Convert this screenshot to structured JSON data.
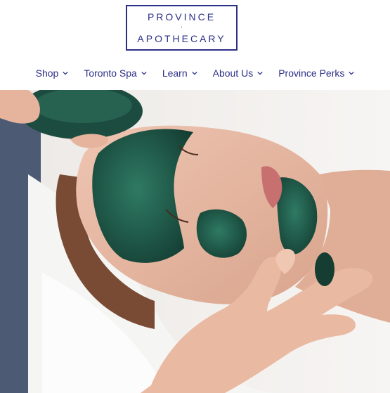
{
  "brand": {
    "line1": "PROVINCE",
    "separator": "·",
    "line2": "APOTHECARY",
    "color": "#2b2f86"
  },
  "nav": {
    "items": [
      {
        "label": "Shop",
        "icon": "chevron-down-icon"
      },
      {
        "label": "Toronto Spa",
        "icon": "chevron-down-icon"
      },
      {
        "label": "Learn",
        "icon": "chevron-down-icon"
      },
      {
        "label": "About Us",
        "icon": "chevron-down-icon"
      },
      {
        "label": "Province Perks",
        "icon": "chevron-down-icon"
      }
    ]
  },
  "hero": {
    "colors": {
      "mask_green": "#1f5b4a",
      "skin": "#e7b9a4",
      "towel": "#f5f5f3",
      "hair": "#7a4b34",
      "shirt": "#4c5a73"
    }
  }
}
